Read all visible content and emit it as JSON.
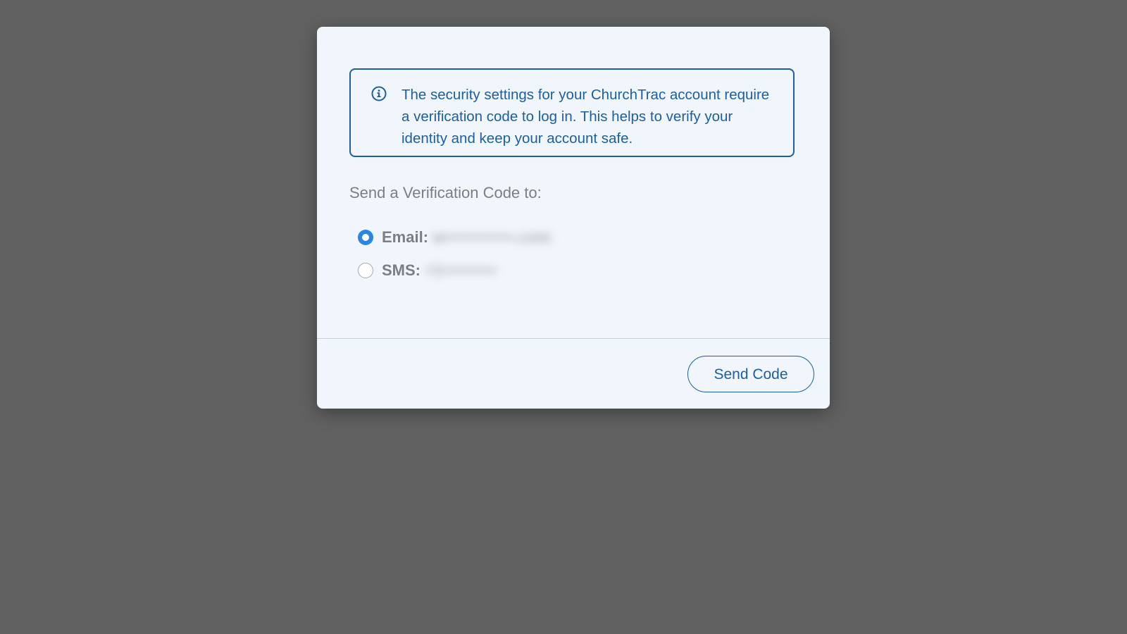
{
  "modal": {
    "info": {
      "icon": "info-circle-icon",
      "message": "The security settings for your ChurchTrac account require a verification code to log in. This helps to verify your identity and keep your account safe."
    },
    "section_label": "Send a Verification Code to:",
    "options": [
      {
        "label": "Email:",
        "value": "w•••••••••••••.com",
        "selected": true
      },
      {
        "label": "SMS:",
        "value": "+1••••••••••",
        "selected": false
      }
    ],
    "footer": {
      "send_label": "Send Code"
    }
  },
  "colors": {
    "backdrop": "#616161",
    "modal_bg": "#f0f6fb",
    "accent": "#1d5fa1",
    "radio_selected": "#2a86e0",
    "muted_text": "#7b7f85"
  }
}
